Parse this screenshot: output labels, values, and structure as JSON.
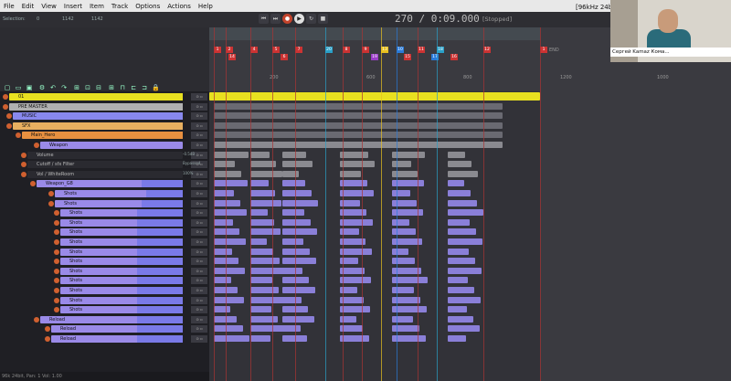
{
  "menu": [
    "File",
    "Edit",
    "View",
    "Insert",
    "Item",
    "Track",
    "Options",
    "Actions",
    "Help"
  ],
  "toolbar": {
    "selection_label": "Selection:",
    "sel_start": "0",
    "sel_end": "1142",
    "sel_len": "1142",
    "position": "270 / 0:09.000",
    "play_state": "[Stopped]",
    "sample_rate": "[96kHz 24bit"
  },
  "ruler": {
    "ticks": [
      "200",
      "600",
      "800",
      "1200",
      "1000"
    ],
    "markers_top": [
      "1",
      "2",
      "4",
      "5",
      "7",
      "20",
      "8",
      "9",
      "13",
      "10",
      "11",
      "18",
      "12",
      "1"
    ],
    "markers_bottom": [
      "14",
      "6",
      "19",
      "15",
      "17",
      "16"
    ],
    "end_label": "END"
  },
  "tracks": [
    {
      "name": "01",
      "color": "#e8e020"
    },
    {
      "name": "PRE MASTER",
      "color": "#b0b0b0"
    },
    {
      "name": "MUSIC",
      "color": "#8888ee"
    },
    {
      "name": "SFX",
      "color": "#e8b060"
    },
    {
      "name": "Main_Hero",
      "color": "#e89040"
    },
    {
      "name": "Weapon",
      "color": "#9a8ae8"
    },
    {
      "name": "Volume",
      "color": "#2a2a30"
    },
    {
      "name": "Cutoff / sfx Filter",
      "color": "#2a2a30"
    },
    {
      "name": "Vol / WhiteRoom",
      "color": "#2a2a30"
    },
    {
      "name": "Weapon_G8",
      "color": "#9a8ae8"
    },
    {
      "name": "Shots",
      "color": "#9a8ae8"
    },
    {
      "name": "Shots",
      "color": "#9a8ae8"
    },
    {
      "name": "Shots",
      "color": "#9a8ae8"
    },
    {
      "name": "Shots",
      "color": "#9a8ae8"
    },
    {
      "name": "Shots",
      "color": "#9a8ae8"
    },
    {
      "name": "Shots",
      "color": "#9a8ae8"
    },
    {
      "name": "Shots",
      "color": "#9a8ae8"
    },
    {
      "name": "Shots",
      "color": "#9a8ae8"
    },
    {
      "name": "Shots",
      "color": "#9a8ae8"
    },
    {
      "name": "Shots",
      "color": "#9a8ae8"
    },
    {
      "name": "Shots",
      "color": "#9a8ae8"
    },
    {
      "name": "Shots",
      "color": "#9a8ae8"
    },
    {
      "name": "Shots",
      "color": "#9a8ae8"
    },
    {
      "name": "Reload",
      "color": "#9a8ae8"
    },
    {
      "name": "Reload",
      "color": "#9a8ae8"
    },
    {
      "name": "Reload",
      "color": "#9a8ae8"
    }
  ],
  "automation_values": [
    "-0.5dB",
    "Bypassed",
    "100%"
  ],
  "webcam": {
    "name": "Сергей Kamaz Кома..."
  },
  "status": "96k 24bit, Pan: 1 Vol: 1.00"
}
